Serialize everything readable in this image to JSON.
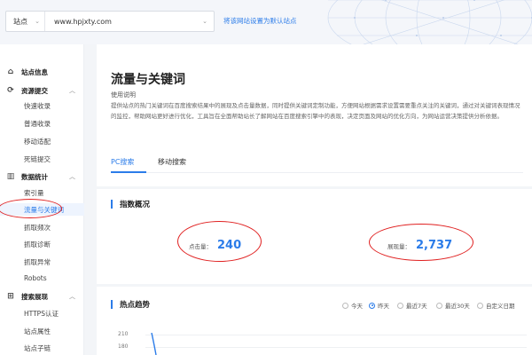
{
  "topbar": {
    "site_type": "站点",
    "site_url": "www.hpjxty.com",
    "set_default": "将该网站设置为默认站点"
  },
  "sidebar": {
    "site_info": "站点信息",
    "resource_submit": {
      "label": "资源提交",
      "items": [
        "快速收录",
        "普通收录",
        "移动适配",
        "死链提交"
      ]
    },
    "data_stats": {
      "label": "数据统计",
      "items": [
        "索引量",
        "流量与关键词",
        "抓取频次",
        "抓取诊断",
        "抓取异常",
        "Robots"
      ]
    },
    "search_display": {
      "label": "搜索展现",
      "items": [
        "HTTPS认证",
        "站点属性",
        "站点子链"
      ]
    }
  },
  "main": {
    "title": "流量与关键词",
    "usage_title": "使用说明",
    "usage_desc": "提供站点的热门关键词在百度搜索结果中的展现及点击量数据，同时提供关键词定制功能，方便网站根据需求设置需要重点关注的关键词，通过对关键词表现情况的监控，帮助网站更好进行优化，工具旨在全面帮助站长了解网站在百度搜索引擎中的表现，决定页面及网站的优化方向，为网站运营决策提供分析依据。",
    "tabs": [
      "PC搜索",
      "移动搜索"
    ],
    "overview": {
      "title": "指数概况",
      "clicks_label": "点击量：",
      "clicks_value": "240",
      "impressions_label": "展现量：",
      "impressions_value": "2,737"
    },
    "trend": {
      "title": "热点趋势",
      "ranges": [
        "今天",
        "昨天",
        "最近7天",
        "最近30天",
        "自定义日期"
      ],
      "selected_range": "昨天",
      "y_ticks": [
        "210",
        "180"
      ]
    }
  },
  "colors": {
    "accent": "#2b7ce9",
    "annotation": "#e02020"
  }
}
